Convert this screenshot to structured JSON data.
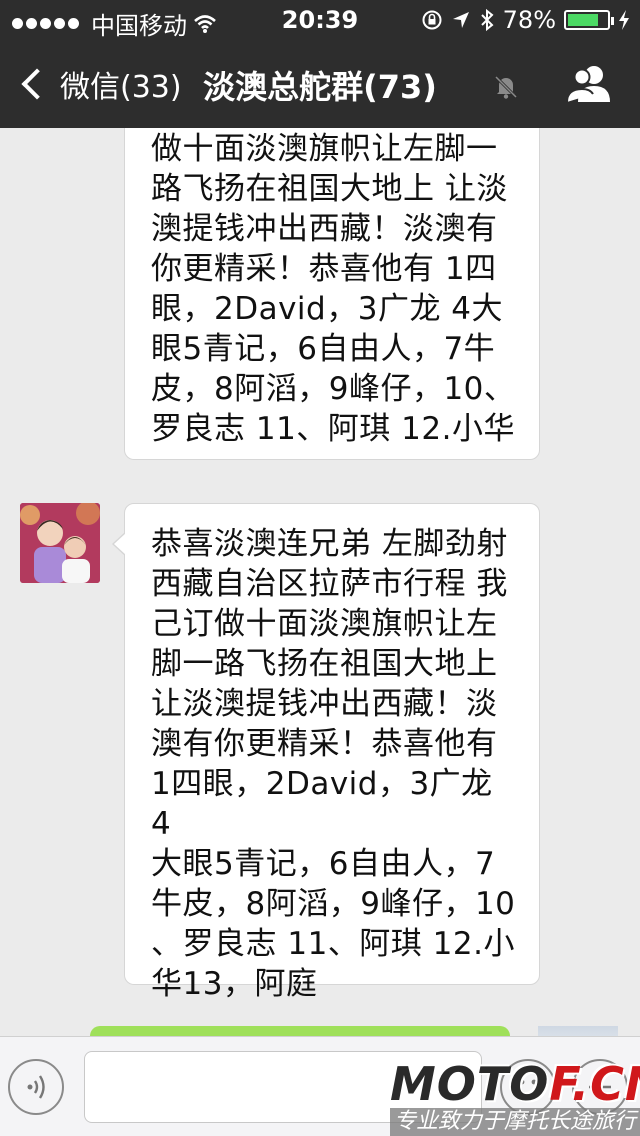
{
  "status_bar": {
    "carrier": "中国移动",
    "time": "20:39",
    "battery_percent": "78%",
    "battery_level": 0.78
  },
  "nav": {
    "back_label": "微信(33)",
    "title": "淡澳总舵群(73)"
  },
  "messages": [
    {
      "text": "做十面淡澳旗帜让左脚一\n路飞扬在祖国大地上 让淡\n澳提钱冲出西藏！淡澳有\n你更精采！恭喜他有 1四\n眼，2David，3广龙  4大\n眼5青记，6自由人，7牛\n皮，8阿滔，9峰仔，10、\n罗良志 11、阿琪 12.小华"
    },
    {
      "text": "恭喜淡澳连兄弟 左脚劲射\n西藏自治区拉萨市行程 我\n己订做十面淡澳旗帜让左\n脚一路飞扬在祖国大地上\n让淡澳提钱冲出西藏！淡\n澳有你更精采！恭喜他有\n1四眼，2David，3广龙  4\n大眼5青记，6自由人，7\n牛皮，8阿滔，9峰仔，10\n、罗良志 11、阿琪 12.小\n华13，阿庭"
    }
  ],
  "watermark": {
    "brand_main": "MOTO",
    "brand_accent": "F.CN",
    "slogan": "专业致力于摩托长途旅行"
  },
  "colors": {
    "bar_bg": "#2d2d2d",
    "chat_bg": "#ebebeb",
    "self_bubble": "#9fe05a",
    "battery_fill": "#4cd964"
  }
}
